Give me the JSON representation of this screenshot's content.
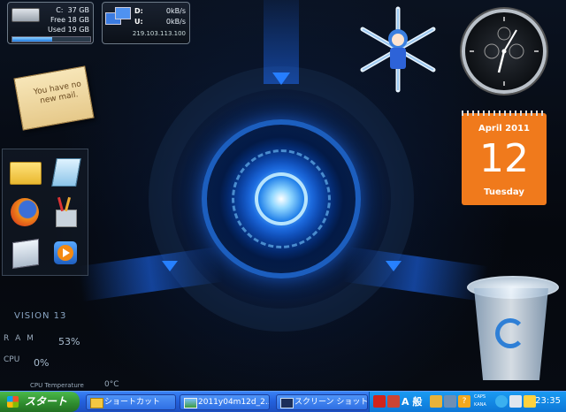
{
  "drive_gadget": {
    "drive": "C:",
    "total": "37 GB",
    "free_label": "Free",
    "free": "18 GB",
    "used_label": "Used",
    "used": "19 GB",
    "used_fraction": 0.51
  },
  "network_gadget": {
    "down_label": "D:",
    "down": "0kB/s",
    "up_label": "U:",
    "up": "0kB/s",
    "ip": "219.103.113.100"
  },
  "mail_gadget": {
    "text_line1": "You have no",
    "text_line2": "new mail."
  },
  "launcher": {
    "items": [
      "folder-icon",
      "notepad-icon",
      "firefox-icon",
      "paint-brushes-icon",
      "calculator-icon",
      "media-player-icon"
    ]
  },
  "calendar": {
    "month_year": "April 2011",
    "day": "12",
    "weekday": "Tuesday"
  },
  "system_monitor": {
    "title": "VISION 13",
    "ram_label": "R A M",
    "ram": "53%",
    "cpu_label": "CPU",
    "cpu": "0%",
    "cpu_temp_label": "CPU Temperature",
    "cpu_temp": "0°C"
  },
  "taskbar": {
    "start_label": "スタート",
    "tasks": [
      {
        "label": "ショートカット",
        "icon": "folder-icon"
      },
      {
        "label": "2011y04m12d_2...",
        "icon": "image-icon"
      },
      {
        "label": "スクリーン ショット",
        "icon": "screen-icon"
      }
    ],
    "tray": {
      "ime": "A 般",
      "caps": "CAPS",
      "kana": "KANA",
      "time": "23:35"
    }
  },
  "colors": {
    "taskbar_blue": "#2462de",
    "start_green": "#2e8b2e",
    "calendar_orange": "#f07a1c",
    "tray_blue": "#0d77d7"
  }
}
